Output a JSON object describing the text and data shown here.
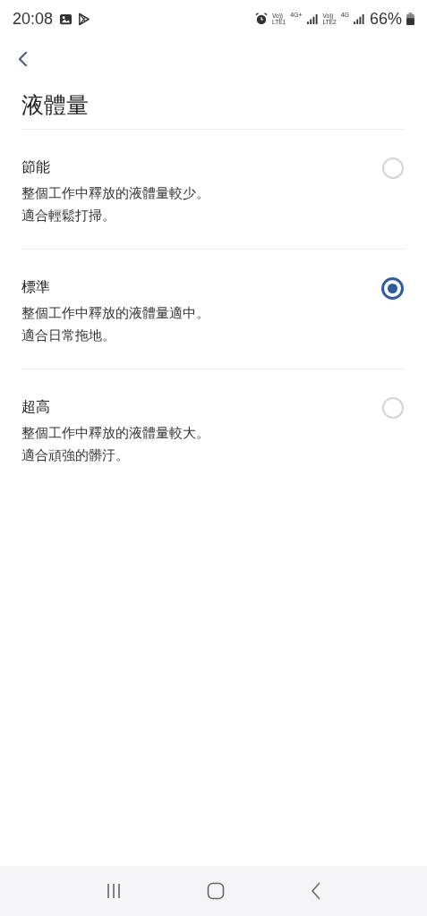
{
  "status_bar": {
    "time": "20:08",
    "sim1_volte": "Vo))",
    "sim1_label": "LTE1",
    "sim1_network": "4G+",
    "sim2_volte": "Vo))",
    "sim2_label": "LTE2",
    "sim2_network": "4G",
    "battery": "66%"
  },
  "header": {
    "title": "液體量"
  },
  "options": [
    {
      "label": "節能",
      "description": [
        "整個工作中釋放的液體量較少。",
        "適合輕鬆打掃。"
      ],
      "selected": false
    },
    {
      "label": "標準",
      "description": [
        "整個工作中釋放的液體量適中。",
        "適合日常拖地。"
      ],
      "selected": true
    },
    {
      "label": "超高",
      "description": [
        "整個工作中釋放的液體量較大。",
        "適合頑強的髒汙。"
      ],
      "selected": false
    }
  ]
}
